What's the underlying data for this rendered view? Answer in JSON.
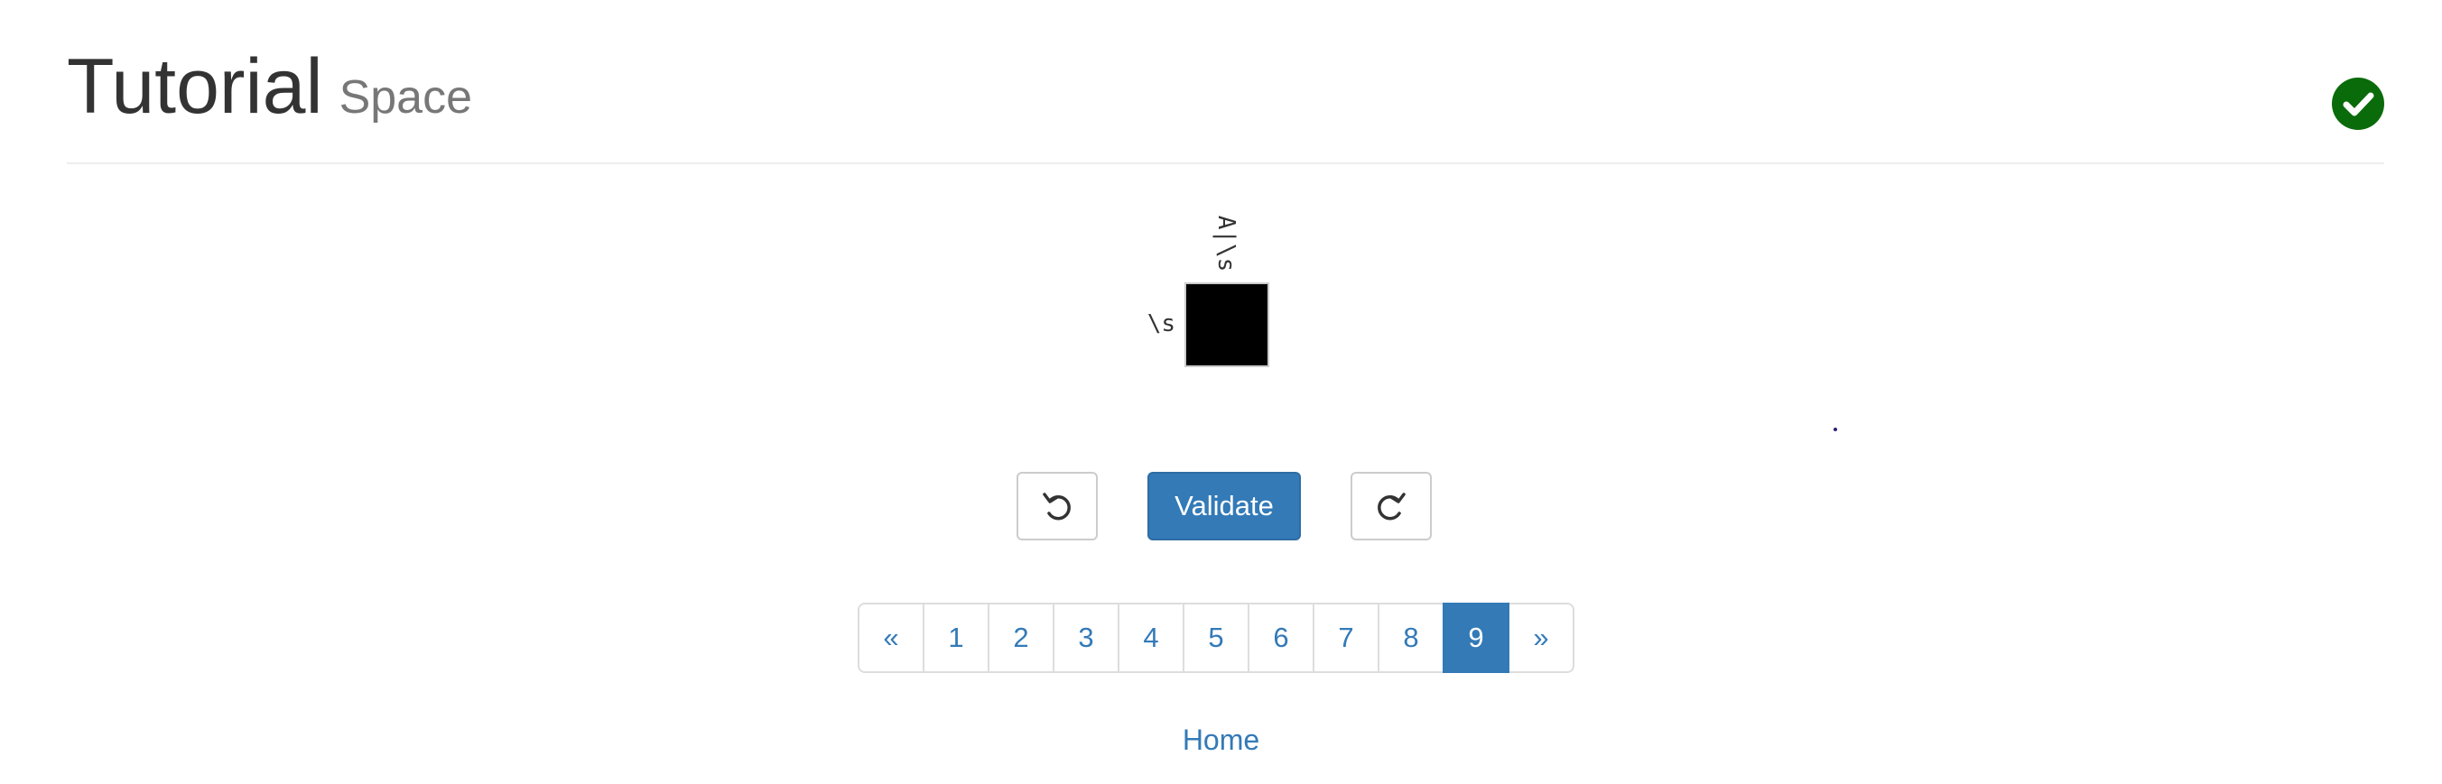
{
  "header": {
    "title": "Tutorial",
    "subtitle": "Space",
    "status_icon": "check-circle-icon",
    "status_color": "#0a6b0a"
  },
  "puzzle": {
    "column_clue": "A|\\s",
    "row_clue": "\\s",
    "cell_state": "filled",
    "cell_color": "#000000"
  },
  "controls": {
    "undo_icon": "undo-icon",
    "validate_label": "Validate",
    "redo_icon": "redo-icon",
    "accent_color": "#337ab7"
  },
  "pagination": {
    "prev_label": "«",
    "pages": [
      "1",
      "2",
      "3",
      "4",
      "5",
      "6",
      "7",
      "8",
      "9"
    ],
    "current_page": "9",
    "next_label": "»"
  },
  "footer": {
    "home_label": "Home"
  }
}
